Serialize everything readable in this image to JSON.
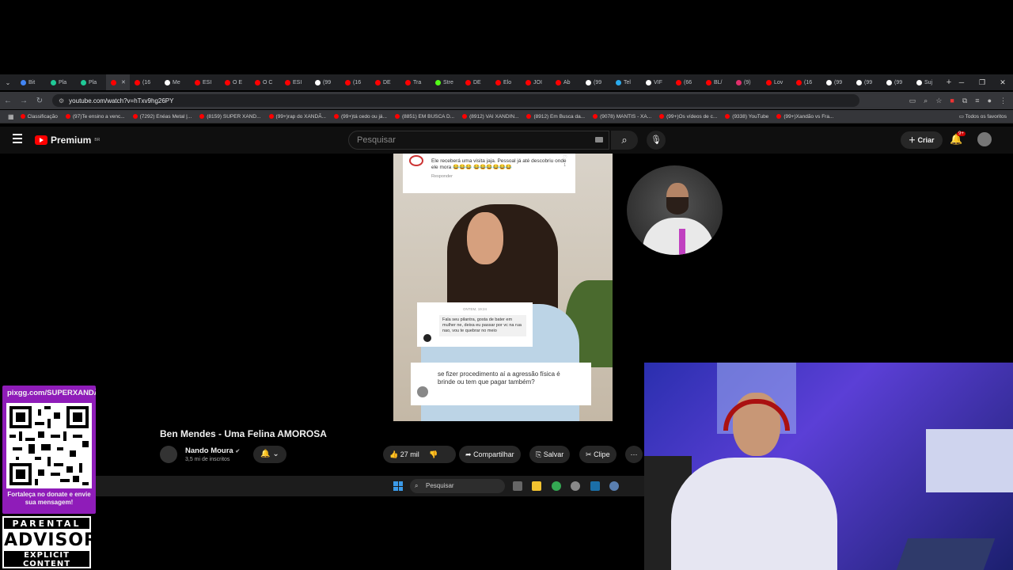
{
  "browser": {
    "tabs": [
      {
        "label": "Bit",
        "color": "#4285f4"
      },
      {
        "label": "Pla",
        "color": "#20c997"
      },
      {
        "label": "Pla",
        "color": "#20c997"
      },
      {
        "label": "",
        "color": "#ff0000",
        "active": true
      },
      {
        "label": "(16",
        "color": "#ff0000"
      },
      {
        "label": "Me",
        "color": "#ffffff"
      },
      {
        "label": "ESI",
        "color": "#ff0000"
      },
      {
        "label": "O E",
        "color": "#ff0000"
      },
      {
        "label": "O C",
        "color": "#ff0000"
      },
      {
        "label": "ESI",
        "color": "#ff0000"
      },
      {
        "label": "(99",
        "color": "#ffffff"
      },
      {
        "label": "(16",
        "color": "#ff0000"
      },
      {
        "label": "DE",
        "color": "#ff0000"
      },
      {
        "label": "Tra",
        "color": "#ff0000"
      },
      {
        "label": "Stre",
        "color": "#53fc18"
      },
      {
        "label": "DE",
        "color": "#ff0000"
      },
      {
        "label": "Elo",
        "color": "#ff0000"
      },
      {
        "label": "JOI",
        "color": "#ff0000"
      },
      {
        "label": "Ab",
        "color": "#ff0000"
      },
      {
        "label": "(99",
        "color": "#ffffff"
      },
      {
        "label": "Tel",
        "color": "#2aabee"
      },
      {
        "label": "VIF",
        "color": "#ffffff"
      },
      {
        "label": "(66",
        "color": "#ff0000"
      },
      {
        "label": "BL/",
        "color": "#ff0000"
      },
      {
        "label": "(9)",
        "color": "#e1306c"
      },
      {
        "label": "Lov",
        "color": "#ff0000"
      },
      {
        "label": "(16",
        "color": "#ff0000"
      },
      {
        "label": "(99",
        "color": "#ffffff"
      },
      {
        "label": "(99",
        "color": "#ffffff"
      },
      {
        "label": "(99",
        "color": "#ffffff"
      },
      {
        "label": "Suj",
        "color": "#ffffff"
      }
    ],
    "new_tab": "+",
    "url": "youtube.com/watch?v=hTxv9hg26PY",
    "bookmarks": [
      "Classificação",
      "(97)Te ensino a venc...",
      "(7292) Enéas Metal |...",
      "(8159) SUPER XAND...",
      "(99+)rap do XANDÃ...",
      "(99+)tá cedo ou já...",
      "(8851) EM BUSCA D...",
      "(8912) VAI XANDIN...",
      "(8912) Em Busca da...",
      "(9078) MANTIS - XA...",
      "(99+)Os vídeos de c...",
      "(9338) YouTube",
      "(99+)Xandão vs Fra..."
    ],
    "all_bookmarks": "Todos os favoritos"
  },
  "youtube": {
    "logo": "Premium",
    "region": "BR",
    "search_placeholder": "Pesquisar",
    "create_label": "Criar",
    "notifications": "9+"
  },
  "video": {
    "comment_top": "Ele receberá uma visita jaja. Pessoal já até descobriu onde ele mora 😂😂😂 😂😂😂😂😂😂",
    "comment_top_reply": "Responder",
    "comment_top_likes": "1",
    "dm_date": "ONTEM, 19:24",
    "dm_text": "Fala seu pilantra, gosta de bater em mulher ne, deixa eu passar por vc na rua nao, vou te quebrar no meio",
    "comment_bottom": "se fizer procedimento aí a agressão física é brinde ou tem que pagar também?",
    "title": "Ben Mendes - Uma Felina AMOROSA",
    "channel": "Nando Moura",
    "subscribers": "3,5 mi de inscritos",
    "likes": "27 mil",
    "share_label": "Compartilhar",
    "save_label": "Salvar",
    "clip_label": "Clipe"
  },
  "taskbar": {
    "search_placeholder": "Pesquisar"
  },
  "overlay": {
    "pix_url": "pixgg.com/SUPERXANDÃO",
    "pix_text": "Fortaleça no donate e envie sua mensagem!",
    "advisory_line1": "PARENTAL",
    "advisory_line2": "ADVISORY",
    "advisory_line3": "EXPLICIT CONTENT"
  }
}
